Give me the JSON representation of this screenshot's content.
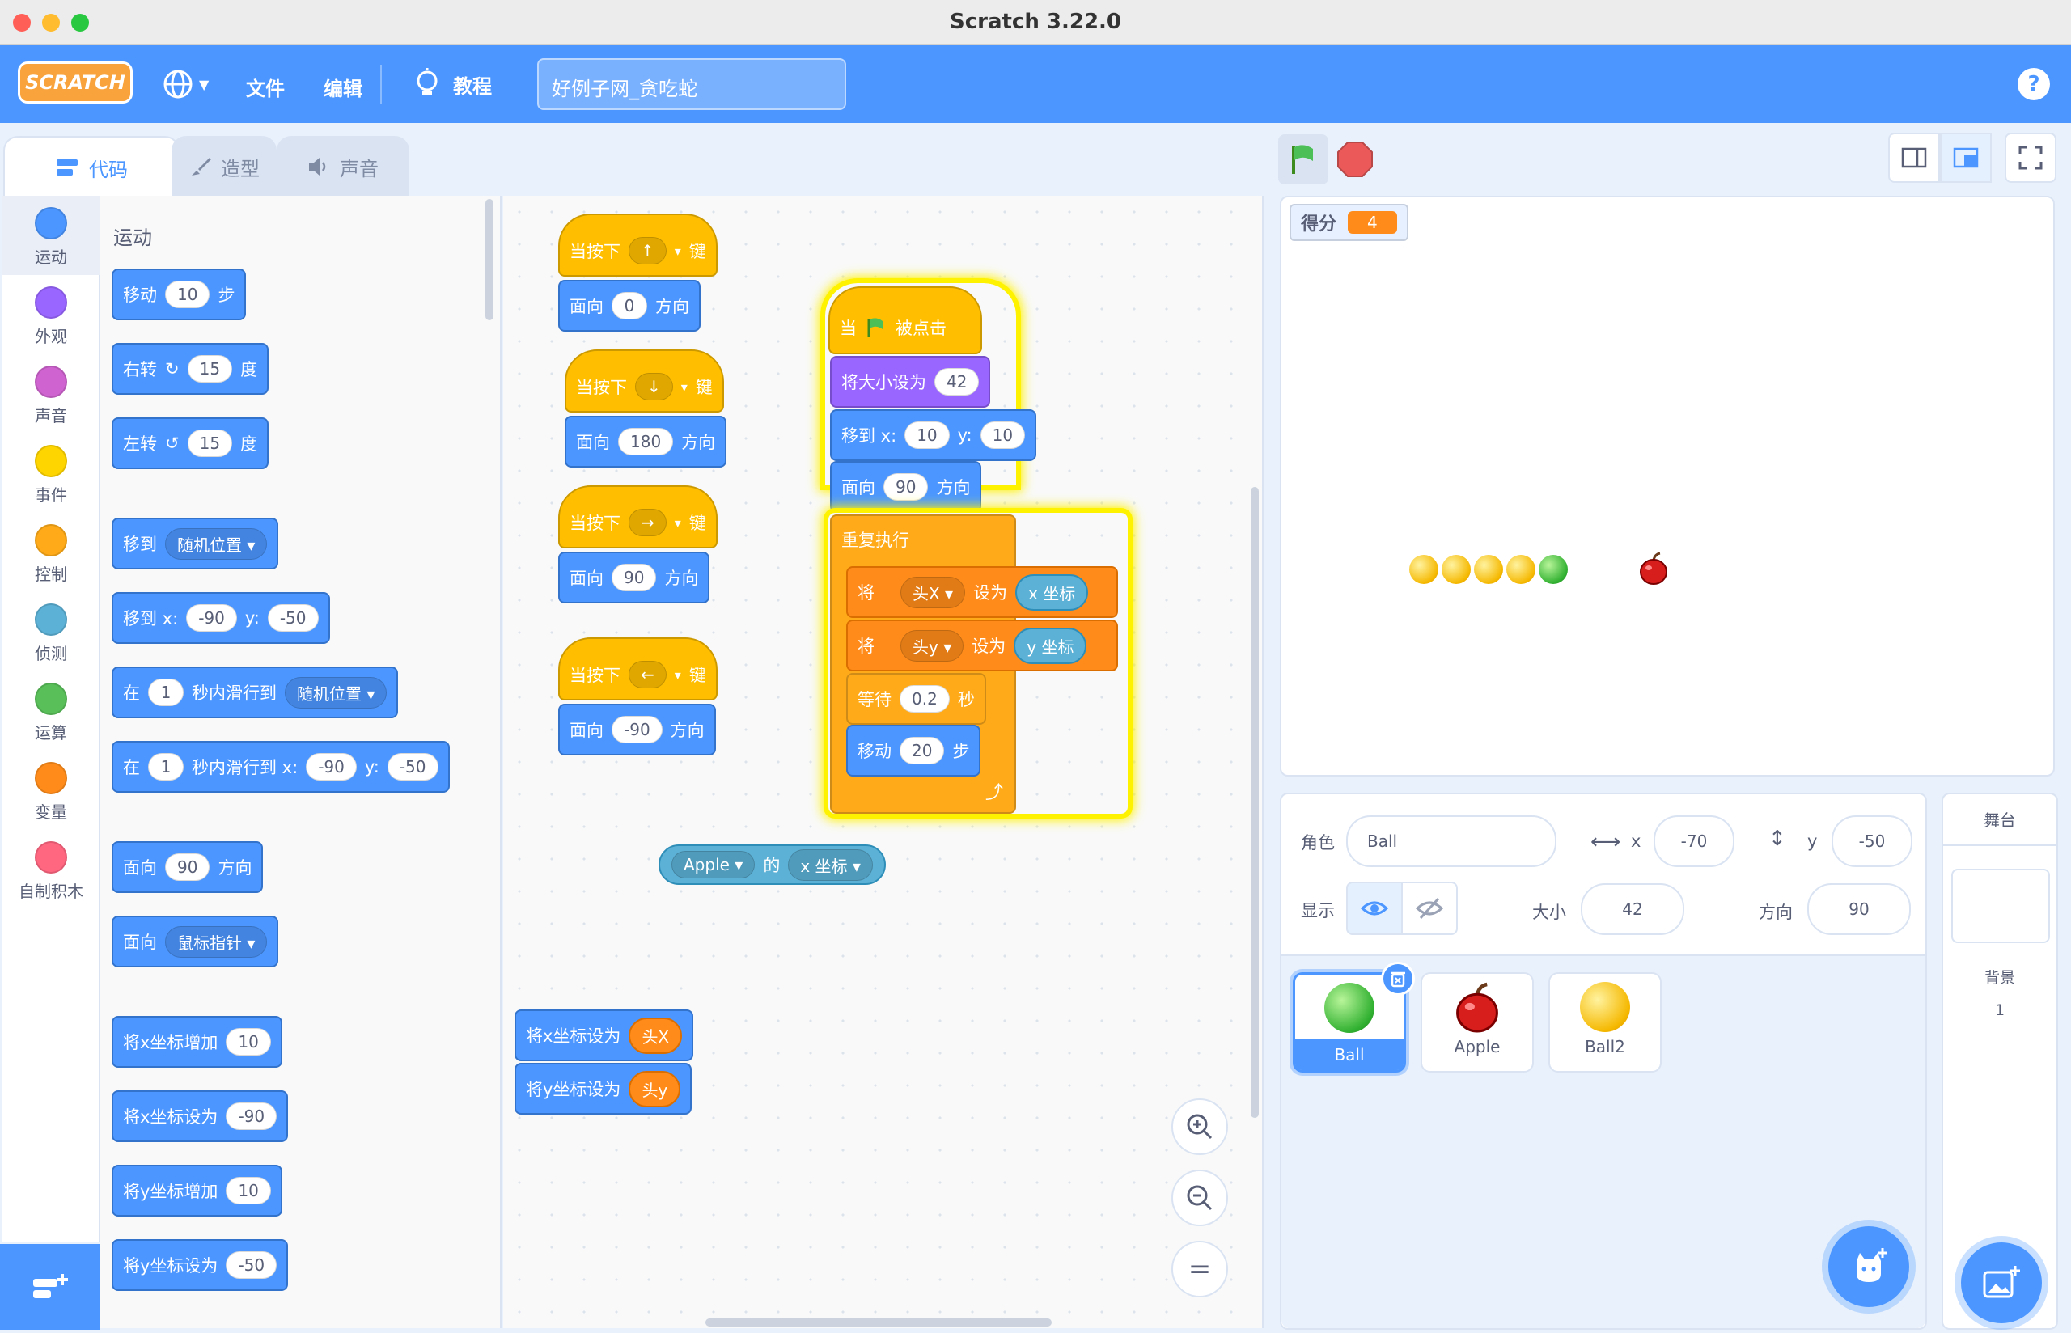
{
  "window": {
    "title": "Scratch 3.22.0"
  },
  "menu": {
    "logo": "SCRATCH",
    "file": "文件",
    "edit": "编辑",
    "tutorials": "教程",
    "project_title": "好例子网_贪吃蛇",
    "help": "?"
  },
  "tabs": [
    {
      "label": "代码"
    },
    {
      "label": "造型"
    },
    {
      "label": "声音"
    }
  ],
  "categories": [
    {
      "label": "运动",
      "color": "#4c97ff"
    },
    {
      "label": "外观",
      "color": "#9966ff"
    },
    {
      "label": "声音",
      "color": "#cf63cf"
    },
    {
      "label": "事件",
      "color": "#ffd500"
    },
    {
      "label": "控制",
      "color": "#ffab19"
    },
    {
      "label": "侦测",
      "color": "#5cb1d6"
    },
    {
      "label": "运算",
      "color": "#59c059"
    },
    {
      "label": "变量",
      "color": "#ff8c1a"
    },
    {
      "label": "自制积木",
      "color": "#ff6680"
    }
  ],
  "palette": {
    "heading": "运动",
    "move": {
      "a": "移动",
      "n": "10",
      "b": "步"
    },
    "turn_right": {
      "a": "右转",
      "n": "15",
      "b": "度"
    },
    "turn_left": {
      "a": "左转",
      "n": "15",
      "b": "度"
    },
    "goto": {
      "a": "移到",
      "opt": "随机位置"
    },
    "goto_xy": {
      "a": "移到 x:",
      "x": "-90",
      "y_label": "y:",
      "y": "-50"
    },
    "glide": {
      "a": "在",
      "n": "1",
      "b": "秒内滑行到",
      "opt": "随机位置"
    },
    "glide_xy": {
      "a": "在",
      "n": "1",
      "b": "秒内滑行到 x:",
      "x": "-90",
      "y_label": "y:",
      "y": "-50"
    },
    "point": {
      "a": "面向",
      "n": "90",
      "b": "方向"
    },
    "point_towards": {
      "a": "面向",
      "opt": "鼠标指针"
    },
    "change_x": {
      "a": "将x坐标增加",
      "n": "10"
    },
    "set_x": {
      "a": "将x坐标设为",
      "n": "-90"
    },
    "change_y": {
      "a": "将y坐标增加",
      "n": "10"
    },
    "set_y": {
      "a": "将y坐标设为",
      "n": "-50"
    }
  },
  "scripts": {
    "when_key_pressed": "当按下",
    "key_suffix": "键",
    "point_label": "面向",
    "direction_label": "方向",
    "s1": {
      "key": "↑",
      "dir": "0"
    },
    "s2": {
      "key": "↓",
      "dir": "180"
    },
    "s3": {
      "key": "→",
      "dir": "90"
    },
    "s4": {
      "key": "←",
      "dir": "-90"
    },
    "main": {
      "when": "当",
      "clicked": "被点击",
      "set_size": "将大小设为",
      "size": "42",
      "goto": "移到 x:",
      "x": "10",
      "y_label": "y:",
      "y": "10",
      "point": "面向",
      "dir": "90",
      "dir_label": "方向",
      "forever": "重复执行",
      "set1": "将",
      "var1": "头X",
      "to": "设为",
      "rep1": "x 坐标",
      "var2": "头y",
      "rep2": "y 坐标",
      "wait": "等待",
      "wait_n": "0.2",
      "sec": "秒",
      "move": "移动",
      "move_n": "20",
      "steps": "步"
    },
    "of_block": {
      "sprite": "Apple",
      "of": "的",
      "prop": "x 坐标"
    },
    "setx_block": {
      "label": "将x坐标设为",
      "var": "头X"
    },
    "sety_block": {
      "label": "将y坐标设为",
      "var": "头y"
    }
  },
  "stage": {
    "monitor_label": "得分",
    "monitor_value": "4"
  },
  "sprite_info": {
    "sprite_label": "角色",
    "sprite_name": "Ball",
    "x_label": "x",
    "x": "-70",
    "y_label": "y",
    "y": "-50",
    "show_label": "显示",
    "size_label": "大小",
    "size": "42",
    "direction_label": "方向",
    "direction": "90"
  },
  "sprites": [
    {
      "name": "Ball"
    },
    {
      "name": "Apple"
    },
    {
      "name": "Ball2"
    }
  ],
  "stage_pane": {
    "title": "舞台",
    "backdrop_label": "背景",
    "backdrop_count": "1"
  }
}
